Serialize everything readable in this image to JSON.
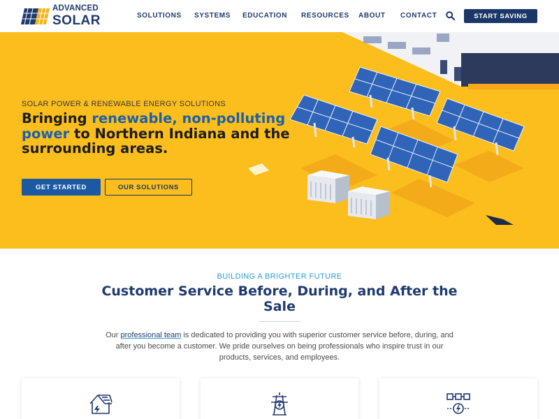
{
  "header": {
    "logo_line1": "ADVANCED",
    "logo_line2": "SOLAR",
    "nav": [
      {
        "label": "SOLUTIONS"
      },
      {
        "label": "SYSTEMS"
      },
      {
        "label": "EDUCATION"
      },
      {
        "label": "RESOURCES"
      },
      {
        "label": "ABOUT"
      },
      {
        "label": "CONTACT"
      }
    ],
    "search_icon": "search-icon",
    "cta_label": "START SAVING"
  },
  "hero": {
    "eyebrow": "SOLAR POWER & RENEWABLE ENERGY SOLUTIONS",
    "title_part1": "Bringing ",
    "title_highlight": "renewable, non-polluting power",
    "title_part2": " to Northern Indiana and the surrounding areas.",
    "primary_button": "GET STARTED",
    "secondary_button": "OUR SOLUTIONS",
    "colors": {
      "background": "#fbbe1c",
      "highlight": "#1d5fa8"
    }
  },
  "section": {
    "eyebrow": "BUILDING A BRIGHTER FUTURE",
    "title": "Customer Service Before, During, and After the Sale",
    "body_pre": "Our ",
    "body_link": "professional team",
    "body_post": " is dedicated to providing you with superior customer service before, during, and after you become a customer. We pride ourselves on being professionals who inspire trust in our products, services, and employees."
  },
  "cards": [
    {
      "icon": "house-solar-icon"
    },
    {
      "icon": "transmission-tower-icon"
    },
    {
      "icon": "energy-grid-icon"
    }
  ]
}
